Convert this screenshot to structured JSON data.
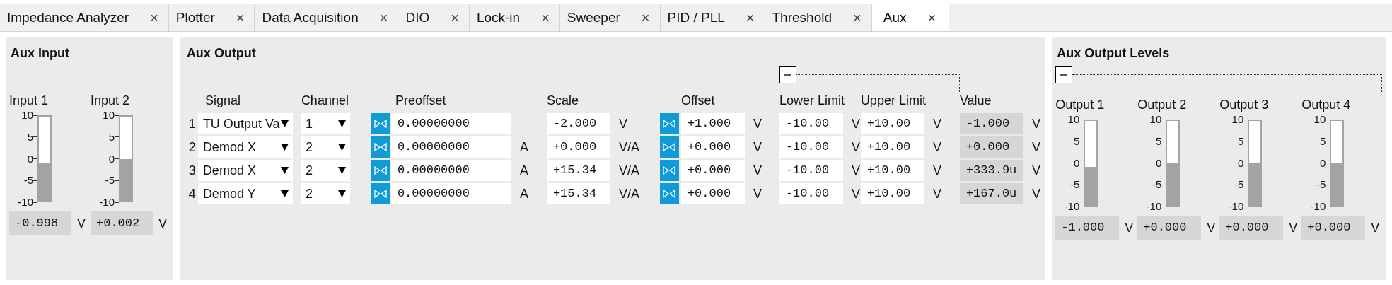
{
  "tabs": [
    {
      "label": "Impedance Analyzer",
      "close": "×",
      "selected": false
    },
    {
      "label": "Plotter",
      "close": "×",
      "selected": false
    },
    {
      "label": "Data Acquisition",
      "close": "×",
      "selected": false
    },
    {
      "label": "DIO",
      "close": "×",
      "selected": false
    },
    {
      "label": "Lock-in",
      "close": "×",
      "selected": false
    },
    {
      "label": "Sweeper",
      "close": "×",
      "selected": false
    },
    {
      "label": "PID / PLL",
      "close": "×",
      "selected": false
    },
    {
      "label": "Threshold",
      "close": "×",
      "selected": false
    },
    {
      "label": "Aux",
      "close": "×",
      "selected": true
    }
  ],
  "aux_input": {
    "title": "Aux Input",
    "meters": [
      {
        "label": "Input 1",
        "ticks": [
          "10",
          "5",
          "0",
          "-5",
          "-10"
        ],
        "level": 0.45,
        "reading": "-0.998",
        "unit": "V"
      },
      {
        "label": "Input 2",
        "ticks": [
          "10",
          "5",
          "0",
          "-5",
          "-10"
        ],
        "level": 0.5,
        "reading": "+0.002",
        "unit": "V"
      }
    ]
  },
  "aux_output": {
    "title": "Aux Output",
    "expanded": true,
    "columns": [
      "Signal",
      "Channel",
      "Preoffset",
      "Scale",
      "Offset",
      "Lower Limit",
      "Upper Limit",
      "Value"
    ],
    "rows": [
      {
        "index": "1",
        "signal": "TU Output Va",
        "channel": "1",
        "preoffset": "0.00000000",
        "scale": "-2.000",
        "scale_unit": "V",
        "offset": "+1.000",
        "offset_unit": "V",
        "lower": "-10.00",
        "lower_unit": "V",
        "upper": "+10.00",
        "upper_unit": "V",
        "value": "-1.000",
        "value_unit": "V"
      },
      {
        "index": "2",
        "signal": "Demod X",
        "channel": "2",
        "preoffset": "0.00000000",
        "preoffset_unit": "A",
        "scale": "+0.000",
        "scale_unit": "V/A",
        "offset": "+0.000",
        "offset_unit": "V",
        "lower": "-10.00",
        "lower_unit": "V",
        "upper": "+10.00",
        "upper_unit": "V",
        "value": "+0.000",
        "value_unit": "V"
      },
      {
        "index": "3",
        "signal": "Demod X",
        "channel": "2",
        "preoffset": "0.00000000",
        "preoffset_unit": "A",
        "scale": "+15.34",
        "scale_unit": "V/A",
        "offset": "+0.000",
        "offset_unit": "V",
        "lower": "-10.00",
        "lower_unit": "V",
        "upper": "+10.00",
        "upper_unit": "V",
        "value": "+333.9u",
        "value_unit": "V"
      },
      {
        "index": "4",
        "signal": "Demod Y",
        "channel": "2",
        "preoffset": "0.00000000",
        "preoffset_unit": "A",
        "scale": "+15.34",
        "scale_unit": "V/A",
        "offset": "+0.000",
        "offset_unit": "V",
        "lower": "-10.00",
        "lower_unit": "V",
        "upper": "+10.00",
        "upper_unit": "V",
        "value": "+167.0u",
        "value_unit": "V"
      }
    ]
  },
  "aux_output_levels": {
    "title": "Aux Output Levels",
    "expanded": true,
    "meters": [
      {
        "label": "Output 1",
        "ticks": [
          "10",
          "5",
          "0",
          "-5",
          "-10"
        ],
        "level": 0.45,
        "reading": "-1.000",
        "unit": "V"
      },
      {
        "label": "Output 2",
        "ticks": [
          "10",
          "5",
          "0",
          "-5",
          "-10"
        ],
        "level": 0.5,
        "reading": "+0.000",
        "unit": "V"
      },
      {
        "label": "Output 3",
        "ticks": [
          "10",
          "5",
          "0",
          "-5",
          "-10"
        ],
        "level": 0.5,
        "reading": "+0.000",
        "unit": "V"
      },
      {
        "label": "Output 4",
        "ticks": [
          "10",
          "5",
          "0",
          "-5",
          "-10"
        ],
        "level": 0.5,
        "reading": "+0.000",
        "unit": "V"
      }
    ]
  }
}
